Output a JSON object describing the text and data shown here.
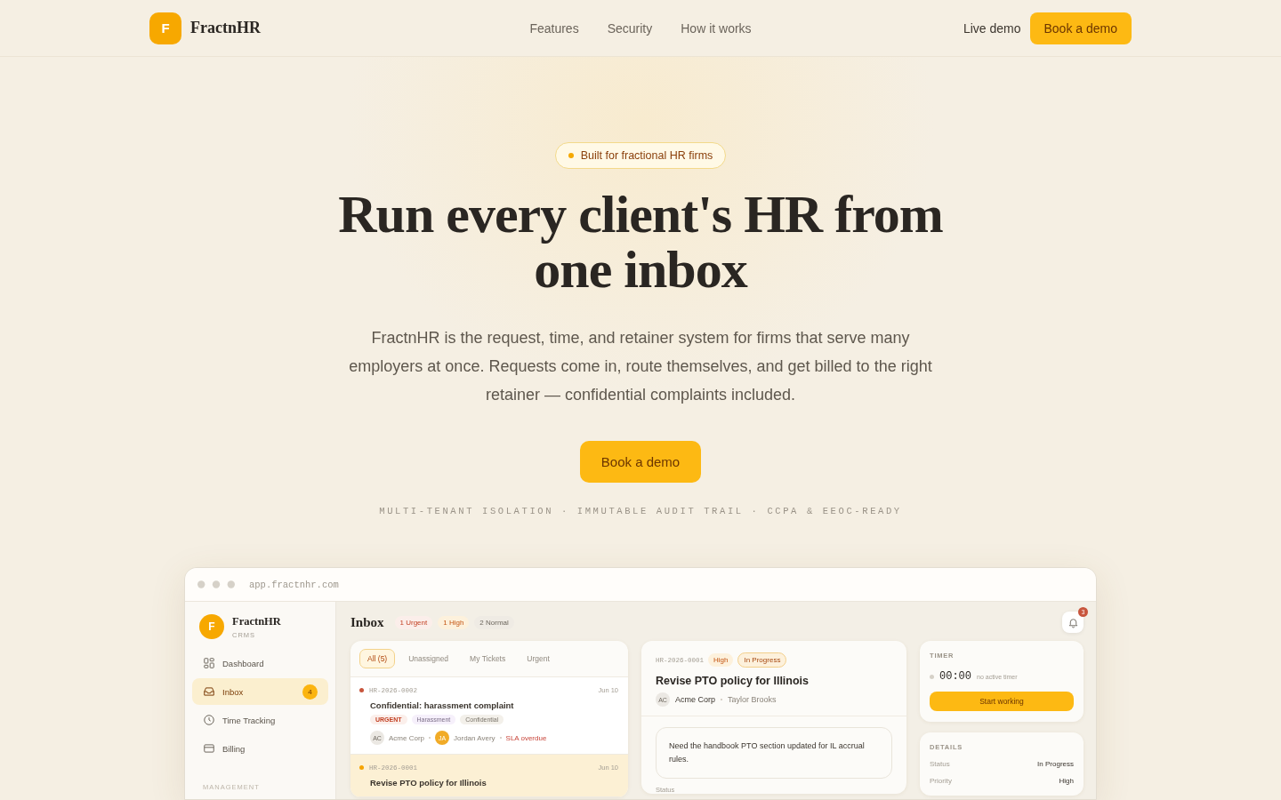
{
  "nav": {
    "brand": "FractnHR",
    "logo_letter": "F",
    "links": [
      "Features",
      "Security",
      "How it works"
    ],
    "live_demo": "Live demo",
    "cta": "Book a demo"
  },
  "hero": {
    "badge": "Built for fractional HR firms",
    "title": "Run every client's HR from one inbox",
    "lead": "FractnHR is the request, time, and retainer system for firms that serve many employers at once. Requests come in, route themselves, and get billed to the right retainer — confidential complaints included.",
    "cta": "Book a demo",
    "features": "MULTI-TENANT ISOLATION · IMMUTABLE AUDIT TRAIL · CCPA & EEOC-READY"
  },
  "app": {
    "url": "app.fractnhr.com",
    "sidebar": {
      "brand": "FractnHR",
      "logo_letter": "F",
      "subtitle": "CRMS",
      "items": [
        {
          "label": "Dashboard",
          "selected": false
        },
        {
          "label": "Inbox",
          "selected": true,
          "badge": "4"
        },
        {
          "label": "Time Tracking",
          "selected": false
        },
        {
          "label": "Billing",
          "selected": false
        }
      ],
      "section": "MANAGEMENT"
    },
    "header": {
      "title": "Inbox",
      "counts": [
        {
          "label": "1 Urgent",
          "kind": "urgent"
        },
        {
          "label": "1 High",
          "kind": "high"
        },
        {
          "label": "2 Normal",
          "kind": "normal"
        }
      ],
      "notifications": "3"
    },
    "filters": [
      {
        "label": "All (5)",
        "selected": true
      },
      {
        "label": "Unassigned",
        "selected": false
      },
      {
        "label": "My Tickets",
        "selected": false
      },
      {
        "label": "Urgent",
        "selected": false
      }
    ],
    "tickets": [
      {
        "id": "HR-2026-0002",
        "date": "Jun 10",
        "title": "Confidential: harassment complaint",
        "color": "#c8553d",
        "selected": false,
        "tags": [
          {
            "label": "URGENT",
            "kind": "urgent"
          },
          {
            "label": "Harassment",
            "kind": "topic"
          },
          {
            "label": "Confidential",
            "kind": "plain"
          }
        ],
        "client_initials": "AC",
        "client": "Acme Corp",
        "assignee_initials": "JA",
        "assignee": "Jordan Avery",
        "alert": "SLA overdue"
      },
      {
        "id": "HR-2026-0001",
        "date": "Jun 10",
        "title": "Revise PTO policy for Illinois",
        "color": "#f5a300",
        "selected": true
      }
    ],
    "detail": {
      "id": "HR-2026-0001",
      "priority": "High",
      "status": "In Progress",
      "title": "Revise PTO policy for Illinois",
      "client_initials": "AC",
      "client": "Acme Corp",
      "assignee": "Taylor Brooks",
      "message": "Need the handbook PTO section updated for IL accrual rules.",
      "field_label": "Status"
    },
    "timer": {
      "heading": "TIMER",
      "time": "00:00",
      "note": "no active timer",
      "button": "Start working"
    },
    "details": {
      "heading": "DETAILS",
      "rows": [
        {
          "label": "Status",
          "value": "In Progress"
        },
        {
          "label": "Priority",
          "value": "High"
        }
      ]
    }
  }
}
